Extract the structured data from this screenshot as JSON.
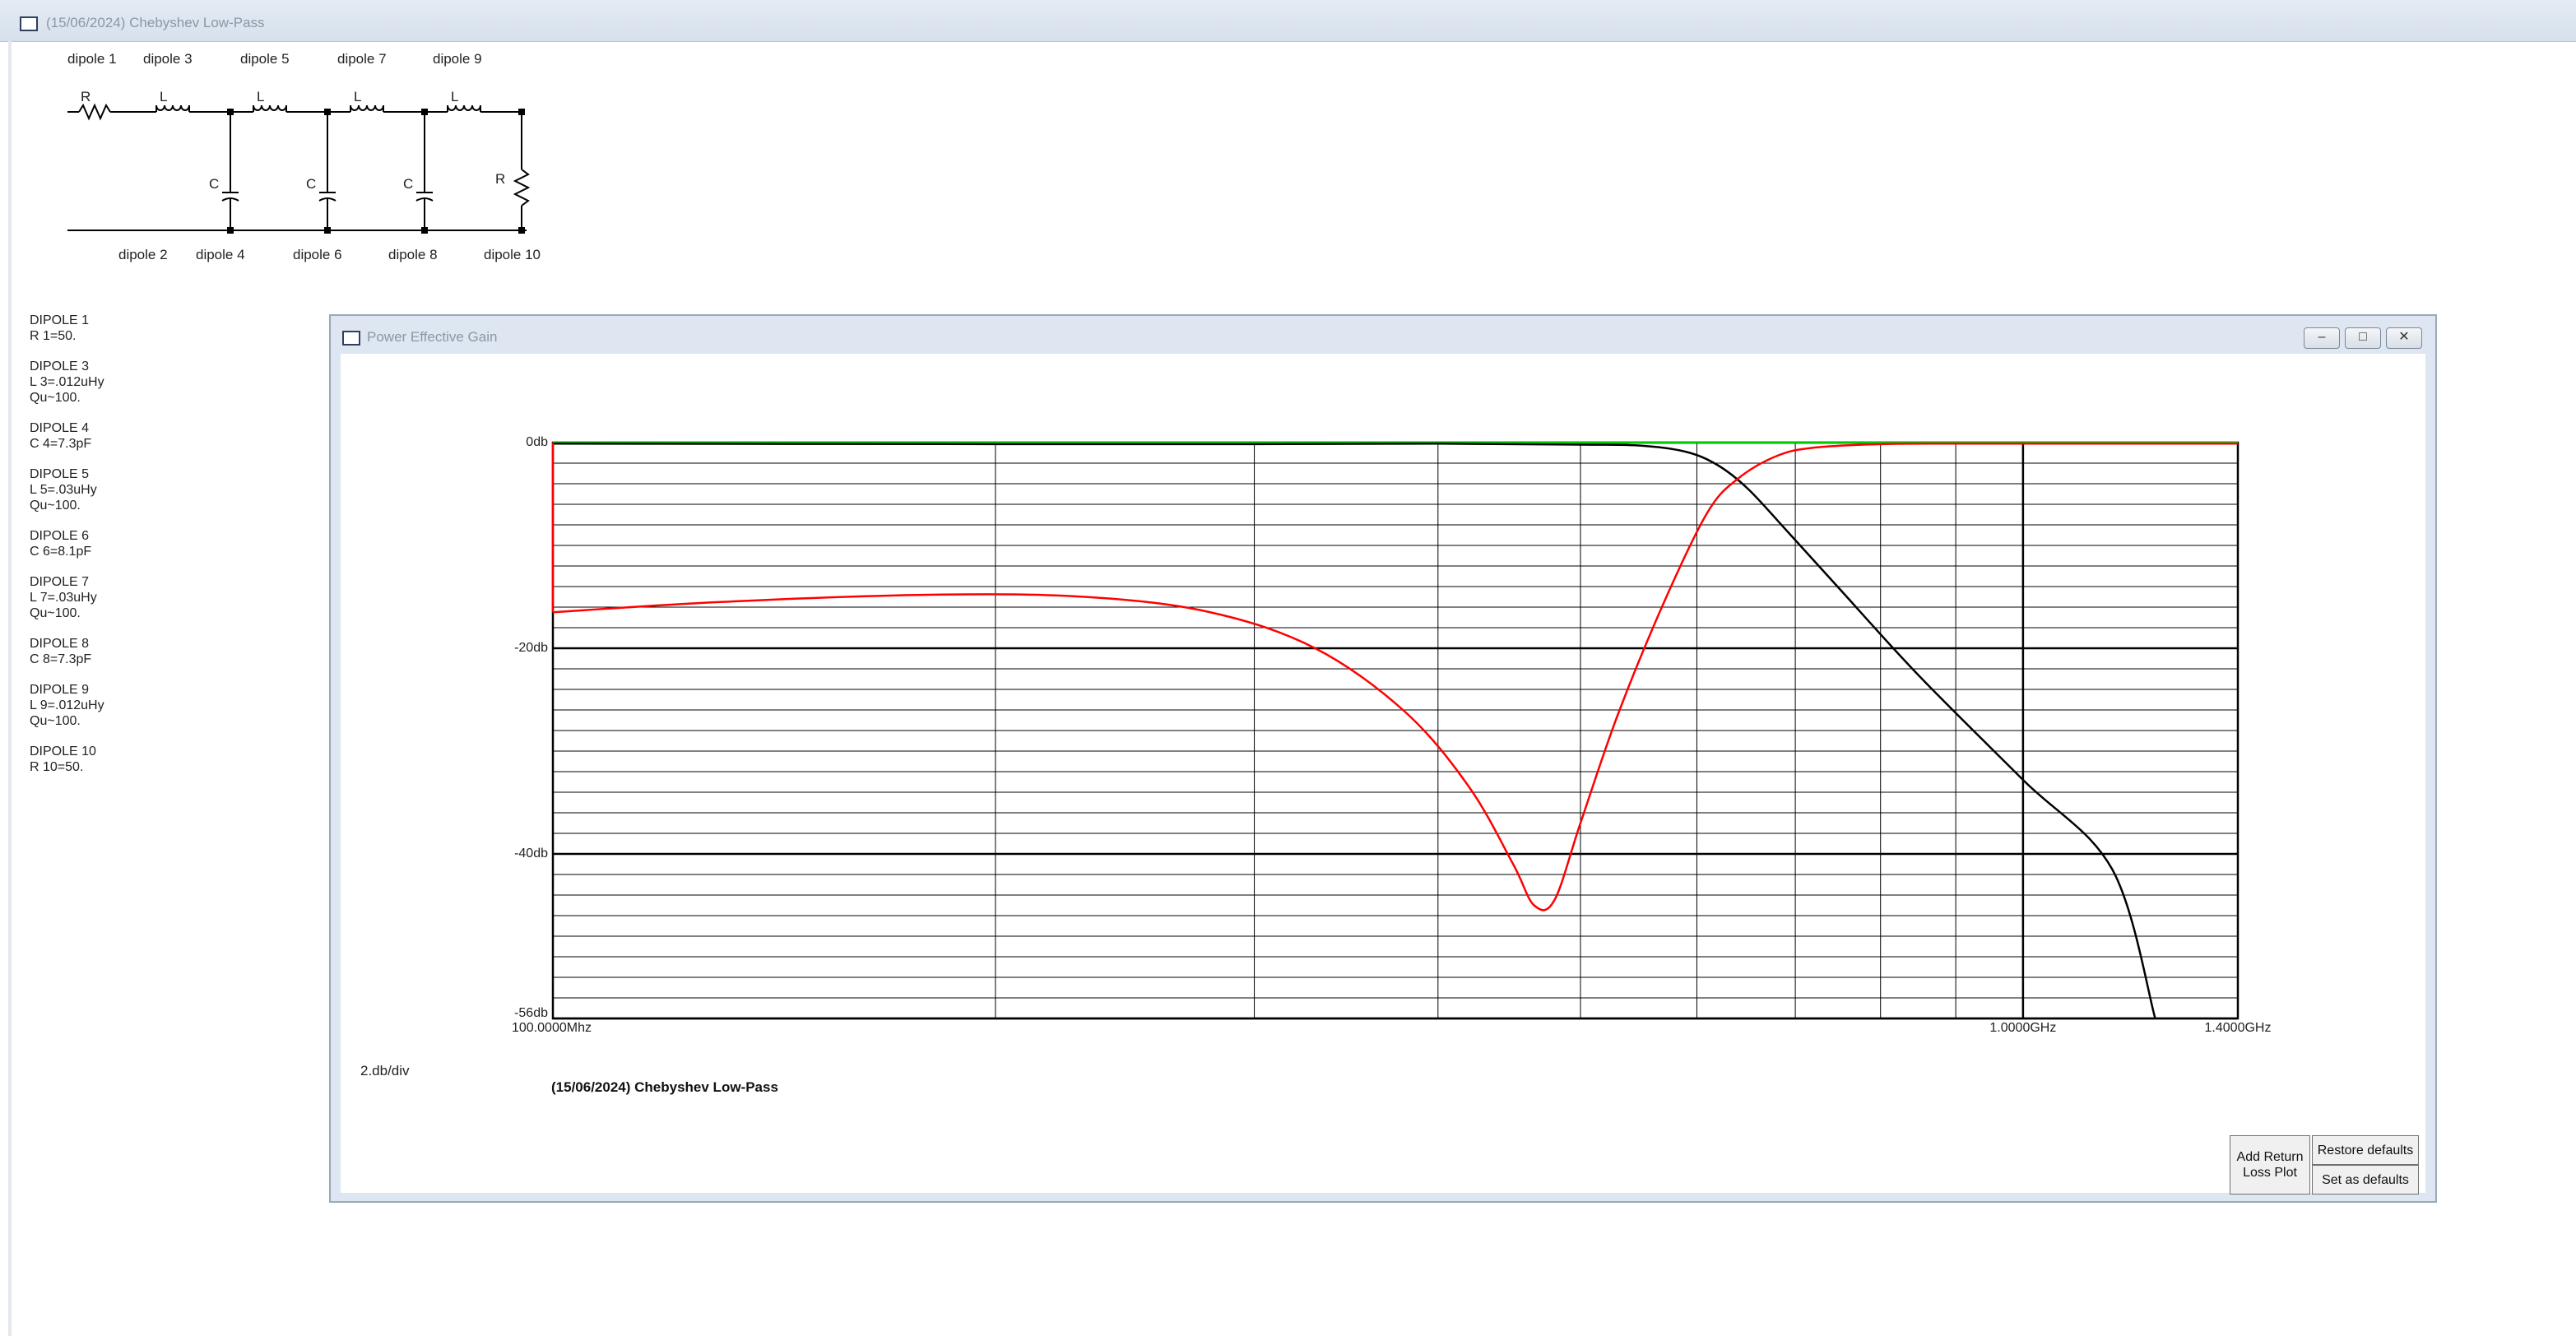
{
  "app": {
    "title": "(15/06/2024) Chebyshev Low-Pass",
    "icon": "app-window-icon"
  },
  "schematic": {
    "top_labels": [
      "dipole 1",
      "dipole 3",
      "dipole 5",
      "dipole 7",
      "dipole 9"
    ],
    "bottom_labels": [
      "dipole 2",
      "dipole 4",
      "dipole 6",
      "dipole 8",
      "dipole 10"
    ],
    "resistor_label": "R",
    "inductor_label": "L",
    "capacitor_label": "C"
  },
  "dipoles": [
    {
      "name": "DIPOLE 1",
      "lines": [
        "R 1=50."
      ]
    },
    {
      "name": "DIPOLE 3",
      "lines": [
        "L 3=.012uHy",
        "Qu~100."
      ]
    },
    {
      "name": "DIPOLE 4",
      "lines": [
        "C 4=7.3pF"
      ]
    },
    {
      "name": "DIPOLE 5",
      "lines": [
        "L 5=.03uHy",
        "Qu~100."
      ]
    },
    {
      "name": "DIPOLE 6",
      "lines": [
        "C 6=8.1pF"
      ]
    },
    {
      "name": "DIPOLE 7",
      "lines": [
        "L 7=.03uHy",
        "Qu~100."
      ]
    },
    {
      "name": "DIPOLE 8",
      "lines": [
        "C 8=7.3pF"
      ]
    },
    {
      "name": "DIPOLE 9",
      "lines": [
        "L 9=.012uHy",
        "Qu~100."
      ]
    },
    {
      "name": "DIPOLE 10",
      "lines": [
        "R 10=50."
      ]
    }
  ],
  "plot_window": {
    "title": "Power Effective Gain",
    "scale_label": "2.db/div",
    "plot_title": "(15/06/2024) Chebyshev Low-Pass",
    "buttons": {
      "add_return_loss": "Add Return Loss Plot",
      "restore_defaults": "Restore defaults",
      "set_as_defaults": "Set as defaults"
    }
  },
  "chart_data": {
    "type": "line",
    "xscale": "log",
    "xlim_mhz": [
      100,
      1400
    ],
    "ylim_db": [
      -56,
      0
    ],
    "x_tick_labels": [
      "100.0000Mhz",
      "1.0000GHz",
      "1.4000GHz"
    ],
    "y_tick_labels": [
      "0db",
      "-20db",
      "-40db",
      "-56db"
    ],
    "y_minor_step_db": 2,
    "grid": true,
    "series": [
      {
        "color": "#000000",
        "x_mhz": [
          100,
          200,
          300,
          400,
          500,
          550,
          590,
          620,
          650,
          690,
          750,
          850,
          1000,
          1150,
          1230
        ],
        "y_db": [
          -0.1,
          -0.15,
          -0.15,
          -0.1,
          -0.2,
          -0.3,
          -0.9,
          -2.2,
          -4.5,
          -8.5,
          -14.2,
          -22.7,
          -32.8,
          -41.5,
          -56
        ]
      },
      {
        "color": "#ff0000",
        "x_mhz": [
          100,
          130,
          180,
          230,
          280,
          330,
          380,
          420,
          450,
          465,
          480,
          500,
          530,
          570,
          610,
          640,
          680,
          720,
          800,
          900,
          1000,
          1400
        ],
        "y_db": [
          -16.5,
          -15.5,
          -14.8,
          -15.0,
          -16.5,
          -20,
          -26.2,
          -33.5,
          -41,
          -45,
          -44.5,
          -37,
          -26.5,
          -15.5,
          -6.8,
          -3.5,
          -1.3,
          -0.5,
          -0.15,
          -0.1,
          -0.1,
          -0.1
        ]
      },
      {
        "color": "#00cc00",
        "x_mhz": [
          100,
          1400
        ],
        "y_db": [
          0,
          0
        ]
      }
    ]
  }
}
